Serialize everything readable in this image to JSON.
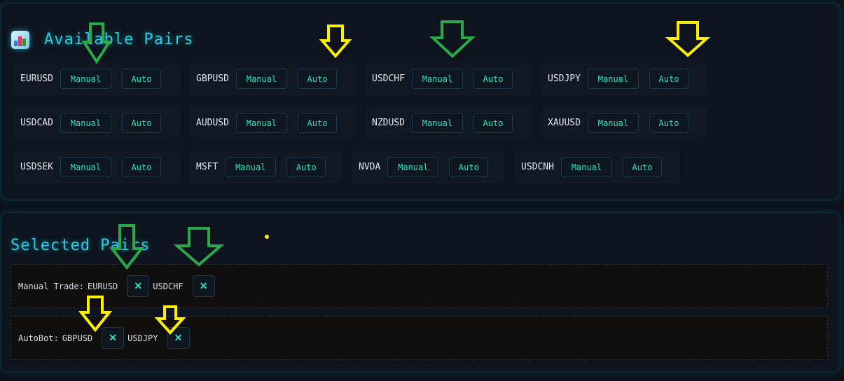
{
  "available": {
    "title": "Available Pairs",
    "icon": "bar-chart-icon",
    "pairs": [
      {
        "name": "EURUSD",
        "manual": "Manual",
        "auto": "Auto"
      },
      {
        "name": "GBPUSD",
        "manual": "Manual",
        "auto": "Auto"
      },
      {
        "name": "USDCHF",
        "manual": "Manual",
        "auto": "Auto"
      },
      {
        "name": "USDJPY",
        "manual": "Manual",
        "auto": "Auto"
      },
      {
        "name": "USDCAD",
        "manual": "Manual",
        "auto": "Auto"
      },
      {
        "name": "AUDUSD",
        "manual": "Manual",
        "auto": "Auto"
      },
      {
        "name": "NZDUSD",
        "manual": "Manual",
        "auto": "Auto"
      },
      {
        "name": "XAUUSD",
        "manual": "Manual",
        "auto": "Auto"
      },
      {
        "name": "USDSEK",
        "manual": "Manual",
        "auto": "Auto"
      },
      {
        "name": "MSFT",
        "manual": "Manual",
        "auto": "Auto"
      },
      {
        "name": "NVDA",
        "manual": "Manual",
        "auto": "Auto"
      },
      {
        "name": "USDCNH",
        "manual": "Manual",
        "auto": "Auto"
      }
    ]
  },
  "selected": {
    "title": "Selected Pairs",
    "manual_label": "Manual Trade:",
    "manual_pairs": [
      "EURUSD",
      "USDCHF"
    ],
    "auto_label": "AutoBot:",
    "auto_pairs": [
      "GBPUSD",
      "USDJPY"
    ],
    "remove_symbol": "✕"
  },
  "colors": {
    "accent": "#26cfe6",
    "button_text": "#2fe0c0",
    "annotation_green": "#2aa84a",
    "annotation_yellow": "#ffee00"
  }
}
